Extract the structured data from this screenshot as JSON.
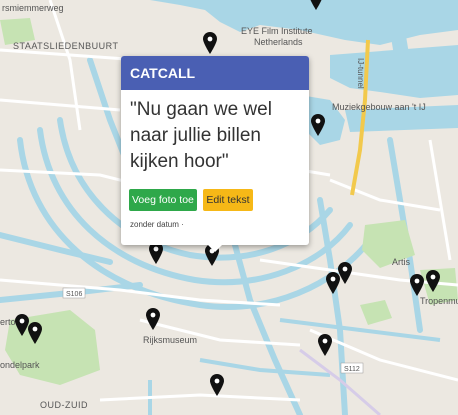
{
  "map_labels": {
    "street_top_left": "rsmiemmerweg",
    "staatsliedenbuurt": "STAATSLIEDENBUURT",
    "eye_institute_1": "EYE Film Institute",
    "eye_institute_2": "Netherlands",
    "ijtunnel": "IJ-tunnel",
    "muziekgebouw": "Muziekgebouw aan 't IJ",
    "artis": "Artis",
    "tropenmuseum": "Tropenmuseum",
    "road_s106": "S106",
    "road_s112": "S112",
    "rijksmuseum": "Rijksmuseum",
    "vondelpark": "ondelpark",
    "oud_zuid": "OUD-ZUID",
    "overtoom": "ertoom"
  },
  "popup": {
    "title": "CATCALL",
    "quote": "\"Nu gaan we wel naar jullie billen kijken hoor\"",
    "add_photo_label": "Voeg foto toe",
    "edit_text_label": "Edit tekst",
    "date_text": "zonder datum ·"
  },
  "colors": {
    "header": "#4a5fb3",
    "add_photo": "#2ea84a",
    "edit_text": "#f6b817",
    "water": "#a9d6e6",
    "land": "#ece8e1",
    "park": "#c6e3b3"
  },
  "icons": {
    "marker": "map-pin-icon"
  }
}
